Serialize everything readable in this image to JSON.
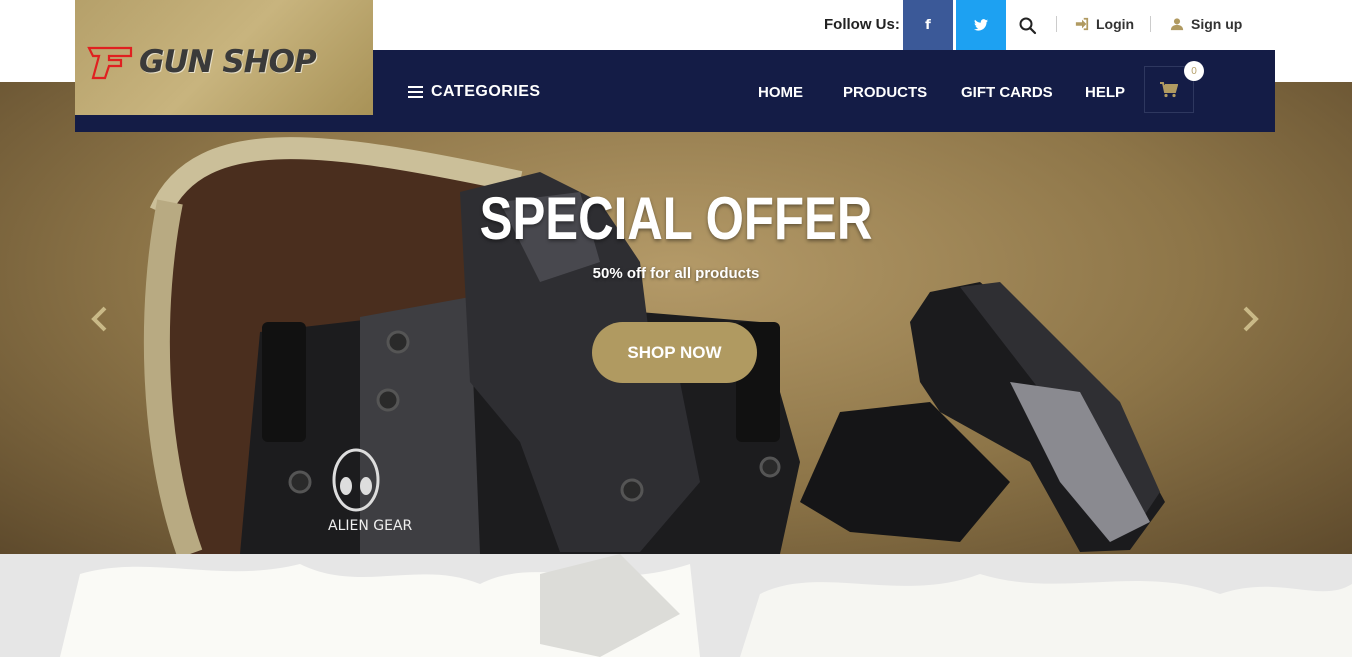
{
  "topbar": {
    "follow_label": "Follow Us:",
    "facebook_label": "f",
    "twitter_label": "t",
    "login_label": "Login",
    "signup_label": "Sign up"
  },
  "logo": {
    "text": "GUN SHOP"
  },
  "nav": {
    "categories_label": "CATEGORIES",
    "items": [
      {
        "label": "HOME"
      },
      {
        "label": "PRODUCTS"
      },
      {
        "label": "GIFT CARDS"
      },
      {
        "label": "HELP"
      }
    ],
    "cart_count": "0"
  },
  "hero": {
    "title": "SPECIAL OFFER",
    "subtitle": "50% off for all products",
    "button_label": "SHOP NOW",
    "brand_mark": "ALIEN GEAR"
  },
  "colors": {
    "gold": "#b09a61",
    "navy": "#141c46",
    "facebook": "#3b5998",
    "twitter": "#1da1f2"
  }
}
